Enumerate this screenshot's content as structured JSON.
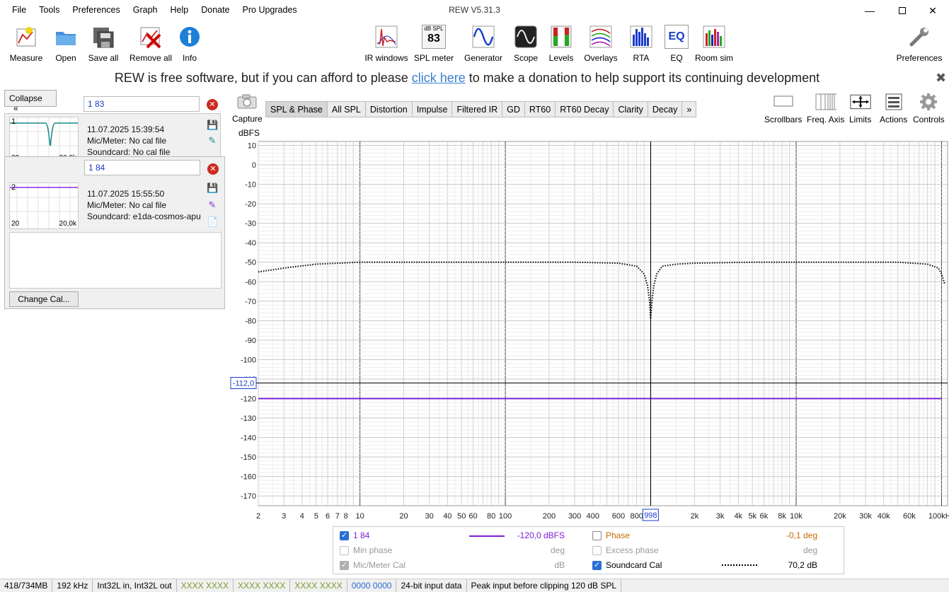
{
  "menu": [
    "File",
    "Tools",
    "Preferences",
    "Graph",
    "Help",
    "Donate",
    "Pro Upgrades"
  ],
  "window_title": "REW V5.31.3",
  "toolbar_left": [
    {
      "label": "Measure",
      "icon": "measure-icon"
    },
    {
      "label": "Open",
      "icon": "folder-icon"
    },
    {
      "label": "Save all",
      "icon": "save-icon"
    },
    {
      "label": "Remove all",
      "icon": "remove-icon"
    },
    {
      "label": "Info",
      "icon": "info-icon"
    }
  ],
  "toolbar_center": [
    {
      "label": "IR windows",
      "icon": "ir-windows-icon"
    },
    {
      "label": "SPL meter",
      "icon": "spl-meter-icon",
      "badge_top": "dB SPL",
      "badge_value": "83"
    },
    {
      "label": "Generator",
      "icon": "generator-icon"
    },
    {
      "label": "Scope",
      "icon": "scope-icon"
    },
    {
      "label": "Levels",
      "icon": "levels-icon"
    },
    {
      "label": "Overlays",
      "icon": "overlays-icon"
    },
    {
      "label": "RTA",
      "icon": "rta-icon"
    },
    {
      "label": "EQ",
      "icon": "eq-icon",
      "badge_value": "EQ"
    },
    {
      "label": "Room sim",
      "icon": "room-sim-icon"
    }
  ],
  "toolbar_right": {
    "label": "Preferences",
    "icon": "wrench-icon"
  },
  "banner": {
    "before": "REW is free software, but if you can afford to please ",
    "link": "click here",
    "after": " to make a donation to help support its continuing development"
  },
  "collapse_label": "Collapse",
  "measurements": [
    {
      "index": "1",
      "name": "1 83",
      "date": "11.07.2025 15:39:54",
      "mic": "Mic/Meter: No cal file",
      "soundcard": "Soundcard: No cal file",
      "thumb_left": "20",
      "thumb_right": "20,0k",
      "color": "#1a8a8a"
    },
    {
      "index": "2",
      "name": "1 84",
      "date": "11.07.2025 15:55:50",
      "mic": "Mic/Meter: No cal file",
      "soundcard": "Soundcard: e1da-cosmos-apu",
      "thumb_left": "20",
      "thumb_right": "20,0k",
      "color": "#8a2be2"
    }
  ],
  "change_cal_label": "Change Cal...",
  "capture_label": "Capture",
  "tabs": [
    "SPL & Phase",
    "All SPL",
    "Distortion",
    "Impulse",
    "Filtered IR",
    "GD",
    "RT60",
    "RT60 Decay",
    "Clarity",
    "Decay",
    "»"
  ],
  "right_tools": [
    {
      "label": "Scrollbars",
      "icon": "scrollbars-icon"
    },
    {
      "label": "Freq. Axis",
      "icon": "freq-axis-icon"
    },
    {
      "label": "Limits",
      "icon": "limits-icon"
    },
    {
      "label": "Actions",
      "icon": "actions-icon"
    },
    {
      "label": "Controls",
      "icon": "gear-icon"
    }
  ],
  "chart_data": {
    "type": "line",
    "ylabel": "dBFS",
    "ylim": [
      -175,
      12
    ],
    "xlim": [
      2,
      110000
    ],
    "x_scale": "log",
    "y_ticks": [
      10,
      0,
      -10,
      -20,
      -30,
      -40,
      -50,
      -60,
      -70,
      -80,
      -90,
      -100,
      -110,
      -120,
      -130,
      -140,
      -150,
      -160,
      -170
    ],
    "x_ticks": [
      {
        "v": 2,
        "l": "2"
      },
      {
        "v": 3,
        "l": "3"
      },
      {
        "v": 4,
        "l": "4"
      },
      {
        "v": 5,
        "l": "5"
      },
      {
        "v": 6,
        "l": "6"
      },
      {
        "v": 7,
        "l": "7"
      },
      {
        "v": 8,
        "l": "8"
      },
      {
        "v": 10,
        "l": "10"
      },
      {
        "v": 20,
        "l": "20"
      },
      {
        "v": 30,
        "l": "30"
      },
      {
        "v": 40,
        "l": "40"
      },
      {
        "v": 50,
        "l": "50"
      },
      {
        "v": 60,
        "l": "60"
      },
      {
        "v": 80,
        "l": "80"
      },
      {
        "v": 100,
        "l": "100"
      },
      {
        "v": 200,
        "l": "200"
      },
      {
        "v": 300,
        "l": "300"
      },
      {
        "v": 400,
        "l": "400"
      },
      {
        "v": 600,
        "l": "600"
      },
      {
        "v": 800,
        "l": "800"
      },
      {
        "v": 2000,
        "l": "2k"
      },
      {
        "v": 3000,
        "l": "3k"
      },
      {
        "v": 4000,
        "l": "4k"
      },
      {
        "v": 5000,
        "l": "5k"
      },
      {
        "v": 6000,
        "l": "6k"
      },
      {
        "v": 8000,
        "l": "8k"
      },
      {
        "v": 10000,
        "l": "10k"
      },
      {
        "v": 20000,
        "l": "20k"
      },
      {
        "v": 30000,
        "l": "30k"
      },
      {
        "v": 40000,
        "l": "40k"
      },
      {
        "v": 60000,
        "l": "60k"
      },
      {
        "v": 100000,
        "l": "100kHz"
      }
    ],
    "cursor": {
      "x": 998,
      "x_label": "998",
      "y": -112,
      "y_label": "-112,0"
    },
    "grid": true,
    "series": [
      {
        "name": "1 84",
        "color": "#7a1fd6",
        "style": "solid",
        "x": [
          2,
          100000
        ],
        "y": [
          -120,
          -120
        ]
      },
      {
        "name": "Soundcard Cal",
        "color": "#000000",
        "style": "dotted",
        "x": [
          2,
          3,
          5,
          10,
          20,
          50,
          100,
          300,
          600,
          800,
          900,
          950,
          980,
          998,
          1020,
          1050,
          1100,
          1200,
          1500,
          2000,
          5000,
          10000,
          20000,
          50000,
          80000,
          95000,
          100000,
          105000
        ],
        "y": [
          -55,
          -53,
          -51,
          -50,
          -50,
          -50,
          -50,
          -50,
          -50.5,
          -52,
          -56,
          -62,
          -70,
          -79,
          -70,
          -62,
          -56,
          -52,
          -51,
          -50.5,
          -50,
          -50,
          -50,
          -50,
          -51,
          -53,
          -56,
          -61
        ]
      }
    ]
  },
  "legend": {
    "row1": {
      "name": "1 84",
      "value": "-120,0 dBFS",
      "phase_label": "Phase",
      "phase_value": "-0,1 deg"
    },
    "row2": {
      "min_phase_label": "Min phase",
      "min_phase_unit": "deg",
      "excess_label": "Excess phase",
      "excess_unit": "deg"
    },
    "row3": {
      "mic_label": "Mic/Meter Cal",
      "mic_unit": "dB",
      "soundcard_label": "Soundcard Cal",
      "soundcard_value": "70,2 dB"
    }
  },
  "status": [
    "418/734MB",
    "192 kHz",
    "Int32L in, Int32L out",
    "XXXX XXXX",
    "XXXX XXXX",
    "XXXX XXXX",
    "0000 0000",
    "24-bit input data",
    "Peak input before clipping 120 dB SPL"
  ]
}
